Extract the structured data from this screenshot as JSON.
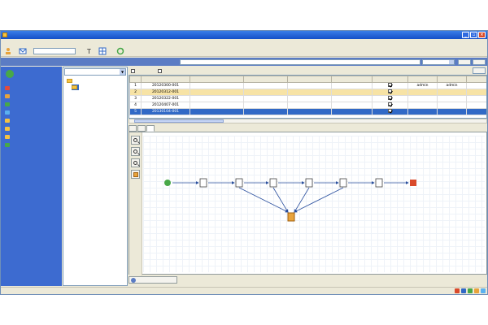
{
  "window": {
    "title": "",
    "accent": "#1550c8"
  },
  "menu": {
    "items": [
      "",
      "",
      "",
      "",
      "",
      ""
    ]
  },
  "toolbar": {
    "search_value": ""
  },
  "infobar": {
    "text": "",
    "input_value": "",
    "combo_value": "",
    "btn1": "",
    "btn2": ""
  },
  "leftnav": {
    "user": "",
    "items": [
      {
        "label": "",
        "icon": "clipboard-icon",
        "color": "#e24b3c"
      },
      {
        "label": "",
        "icon": "document-icon",
        "color": "#e8a33c"
      },
      {
        "label": "",
        "icon": "document-icon",
        "color": "#48a848"
      },
      {
        "label": "",
        "icon": "settings-icon",
        "color": "#5bb1f0"
      },
      {
        "label": "",
        "icon": "calendar-icon",
        "color": "#f6c343"
      },
      {
        "label": "",
        "icon": "folder-icon",
        "color": "#f6c343"
      },
      {
        "label": "",
        "icon": "folder-icon",
        "color": "#f6c343"
      },
      {
        "label": "",
        "icon": "chart-icon",
        "color": "#48a848"
      }
    ]
  },
  "tree": {
    "combo_value": "",
    "root": "",
    "child": ""
  },
  "subtoolbar": {
    "chk1": "",
    "chk2": "",
    "query_btn": ""
  },
  "grid": {
    "headers": [
      "",
      "",
      "",
      "",
      "",
      "",
      "",
      "",
      "",
      ""
    ],
    "rows": [
      {
        "cells": [
          "1",
          "20120300-001",
          "",
          "",
          "",
          "",
          "",
          "admin",
          "admin",
          ""
        ],
        "checked": true,
        "state": "normal"
      },
      {
        "cells": [
          "2",
          "20120312-001",
          "",
          "",
          "",
          "",
          "",
          "",
          "",
          ""
        ],
        "checked": true,
        "state": "selected"
      },
      {
        "cells": [
          "3",
          "20120322-001",
          "",
          "",
          "",
          "",
          "",
          "",
          "",
          ""
        ],
        "checked": true,
        "state": "normal"
      },
      {
        "cells": [
          "4",
          "20120407-001",
          "",
          "",
          "",
          "",
          "",
          "",
          "",
          ""
        ],
        "checked": true,
        "state": "normal"
      },
      {
        "cells": [
          "5",
          "20130104-001",
          "",
          "",
          "",
          "",
          "",
          "",
          "",
          ""
        ],
        "checked": true,
        "state": "highlight"
      }
    ]
  },
  "tabs": [
    "",
    "",
    ""
  ],
  "diagram": {
    "nodes": [
      {
        "id": "start",
        "label": "",
        "icon": "play-icon",
        "color": "#48a848"
      },
      {
        "id": "n1",
        "label": "",
        "icon": "task-icon",
        "color": "#444444"
      },
      {
        "id": "n2",
        "label": "",
        "icon": "form-icon",
        "color": "#444444"
      },
      {
        "id": "n3",
        "label": "",
        "icon": "form-icon",
        "color": "#444444"
      },
      {
        "id": "n4",
        "label": "",
        "icon": "form-icon",
        "color": "#444444"
      },
      {
        "id": "n5",
        "label": "",
        "icon": "form-icon",
        "color": "#444444"
      },
      {
        "id": "n6",
        "label": "",
        "icon": "subflow-icon",
        "color": "#444444"
      },
      {
        "id": "end",
        "label": "",
        "icon": "stop-icon",
        "color": "#d94a2b"
      },
      {
        "id": "hub",
        "label": "",
        "icon": "join-icon",
        "color": "#e8a33c"
      }
    ]
  },
  "bottomtab": {
    "label": ""
  },
  "status": {
    "text": ""
  }
}
